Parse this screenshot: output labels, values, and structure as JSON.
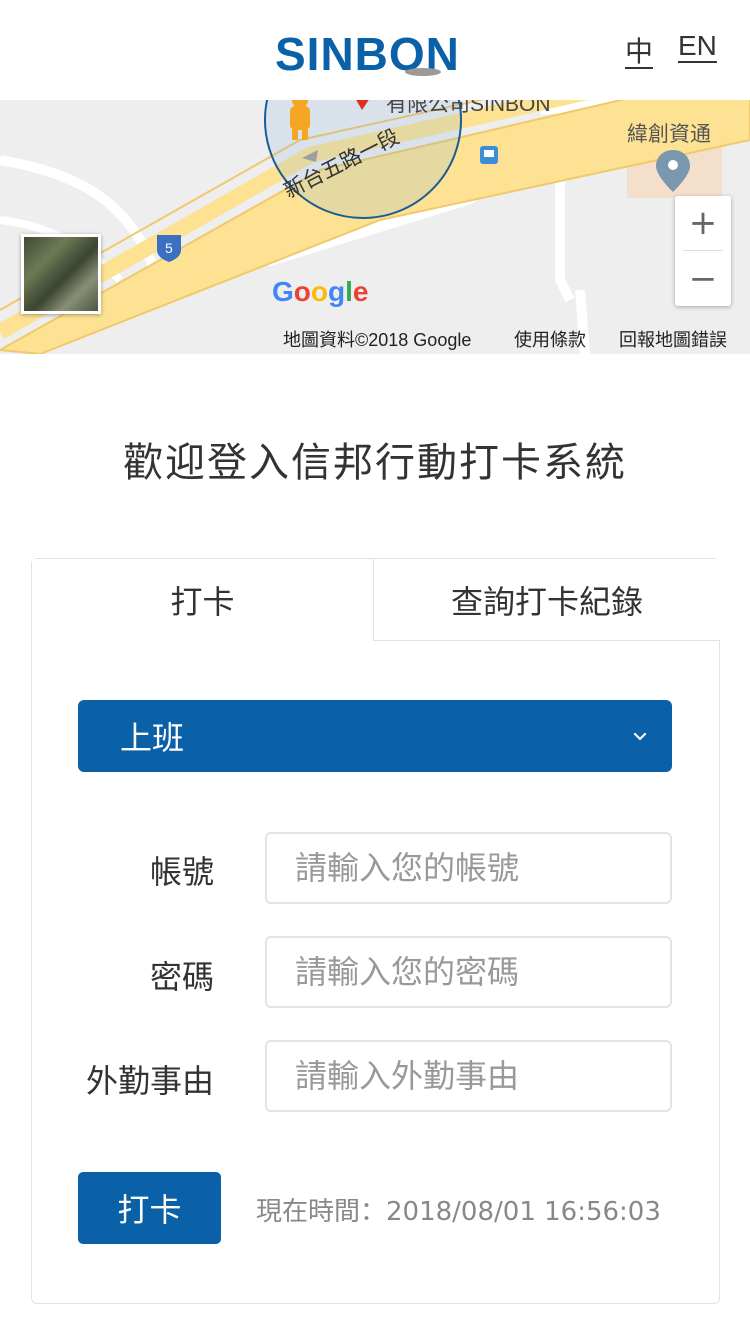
{
  "header": {
    "logo_text": "SINBON",
    "lang_zh": "中",
    "lang_en": "EN"
  },
  "map": {
    "company_label": "有限公司SINBON",
    "road_label": "新台五路一段",
    "poi_label": "緯創資通",
    "route_badge": "5",
    "google_logo": [
      "G",
      "o",
      "o",
      "g",
      "l",
      "e"
    ],
    "google_logo_colors": [
      "#4285F4",
      "#EA4335",
      "#FBBC05",
      "#4285F4",
      "#34A853",
      "#EA4335"
    ],
    "zoom_in": "+",
    "zoom_out": "−",
    "attrib_data": "地圖資料©2018 Google",
    "attrib_terms": "使用條款",
    "attrib_report": "回報地圖錯誤"
  },
  "welcome_title": "歡迎登入信邦行動打卡系統",
  "tabs": [
    {
      "label": "打卡",
      "active": true
    },
    {
      "label": "查詢打卡紀錄",
      "active": false
    }
  ],
  "form": {
    "shift_select": "上班",
    "account_label": "帳號",
    "account_placeholder": "請輸入您的帳號",
    "password_label": "密碼",
    "password_placeholder": "請輸入您的密碼",
    "reason_label": "外勤事由",
    "reason_placeholder": "請輸入外勤事由",
    "punch_button": "打卡",
    "now_time": "現在時間：2018/08/01 16:56:03"
  },
  "colors": {
    "primary": "#0b61a8",
    "road": "#fde293",
    "road_edge": "#f0c96a",
    "map_bg": "#eeeeee"
  }
}
